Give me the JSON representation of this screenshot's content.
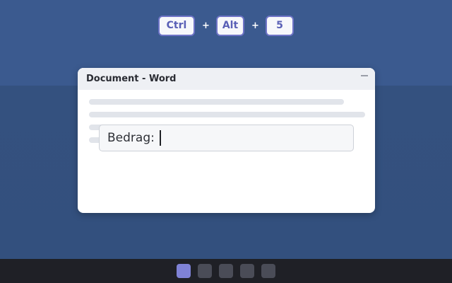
{
  "shortcut": {
    "keys": [
      "Ctrl",
      "Alt",
      "5"
    ],
    "separator": "+"
  },
  "window": {
    "title": "Document - Word",
    "input_label": "Bedrag:"
  },
  "taskbar": {
    "items": [
      "active",
      "inactive",
      "inactive",
      "inactive",
      "inactive"
    ]
  },
  "colors": {
    "background": "#3b5a8f",
    "key_border": "#6f74c7",
    "taskbar": "#1f2026",
    "taskbar_active": "#7f82d6"
  }
}
